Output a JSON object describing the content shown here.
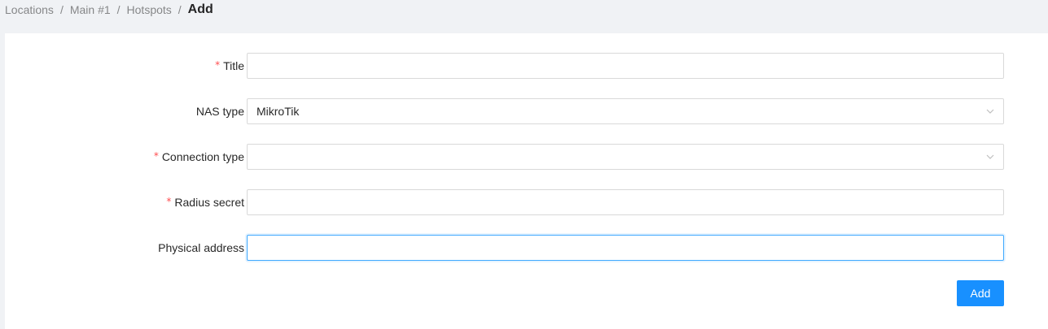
{
  "breadcrumb": {
    "items": [
      "Locations",
      "Main #1",
      "Hotspots"
    ],
    "separator": "/",
    "current": "Add"
  },
  "form": {
    "fields": [
      {
        "label": "Title",
        "required": true,
        "type": "text",
        "value": ""
      },
      {
        "label": "NAS type",
        "required": false,
        "type": "select",
        "value": "MikroTik",
        "icon": "chevron-down-icon"
      },
      {
        "label": "Connection type",
        "required": true,
        "type": "select",
        "value": "",
        "icon": "chevron-down-icon"
      },
      {
        "label": "Radius secret",
        "required": true,
        "type": "text",
        "value": ""
      },
      {
        "label": "Physical address",
        "required": false,
        "type": "text",
        "value": "",
        "focused": true
      }
    ],
    "required_mark": "*",
    "submit_label": "Add"
  },
  "colors": {
    "primary": "#1890ff",
    "required": "#ff4d4f",
    "focus_border": "#40a9ff",
    "page_background": "#f0f2f5"
  }
}
